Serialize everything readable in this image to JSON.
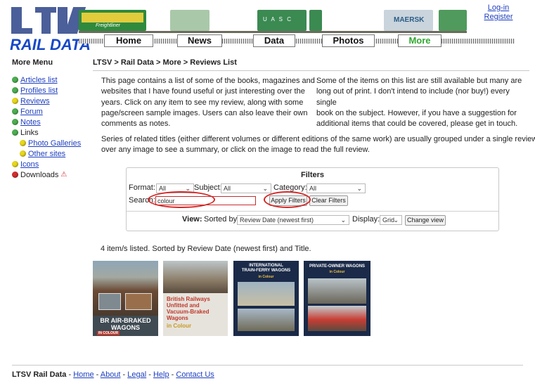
{
  "header": {
    "logo_text": "RAIL DATA",
    "banner": {
      "left_loco_text": "Freightliner",
      "container_text": "U A S C",
      "maersk_text": "MAERSK"
    },
    "login": "Log-in",
    "register": "Register"
  },
  "nav": {
    "tabs": [
      "Home",
      "News",
      "Data",
      "Photos",
      "More"
    ],
    "active": "More"
  },
  "sidebar": {
    "title": "More Menu",
    "items": [
      {
        "label": "Articles list",
        "color": "#4caf50",
        "link": true,
        "indent": false
      },
      {
        "label": "Profiles list",
        "color": "#4caf50",
        "link": true,
        "indent": false
      },
      {
        "label": "Reviews",
        "color": "#e8d81a",
        "link": true,
        "indent": false
      },
      {
        "label": "Forum",
        "color": "#4caf50",
        "link": true,
        "indent": false
      },
      {
        "label": "Notes",
        "color": "#4caf50",
        "link": true,
        "indent": false
      },
      {
        "label": "Links",
        "color": "#4caf50",
        "link": false,
        "indent": false
      },
      {
        "label": "Photo Galleries",
        "color": "#e8d81a",
        "link": true,
        "indent": true
      },
      {
        "label": "Other sites",
        "color": "#e8d81a",
        "link": true,
        "indent": true
      },
      {
        "label": "Icons",
        "color": "#e8d81a",
        "link": true,
        "indent": false
      },
      {
        "label": "Downloads",
        "color": "#d32f2f",
        "link": false,
        "indent": false,
        "warning": "⚠"
      }
    ]
  },
  "main": {
    "breadcrumb": "LTSV > Rail Data > More > Reviews List",
    "intro_left": [
      "This page contains a list of some of the books, magazines and",
      "websites that I have found useful or just interesting over the",
      "years. Click on any item to see my review, along with some",
      "page/screen sample images. Users can also leave their own",
      "comments as notes."
    ],
    "intro_right": [
      "Some of the items on this list are still available but many are",
      "long out of print. I don't intend to include (nor buy!) every single",
      "book on the subject. However, if you have a suggestion for",
      "additional items that could be covered, please get in touch."
    ],
    "series_note": [
      "Series of related titles (either different volumes or different editions of the same work) are usually grouped under a single review. Hover",
      "over any image to see a summary, or click on the image to read the full review."
    ]
  },
  "filters": {
    "title": "Filters",
    "format_label": "Format:",
    "format_value": "All",
    "subject_label": "Subject:",
    "subject_value": "All",
    "category_label": "Category:",
    "category_value": "All",
    "search_label": "Search:",
    "search_value": "colour",
    "apply_label": "Apply Filters",
    "clear_label": "Clear Filters",
    "view_label": "View:",
    "sorted_label": "Sorted by:",
    "sorted_value": "Review Date (newest first)",
    "display_label": "Display:",
    "display_value": "Grid",
    "change_view_label": "Change view",
    "highlight_color": "#d42727"
  },
  "results": {
    "count_text": "4 item/s listed. Sorted by Review Date (newest first) and Title.",
    "covers": [
      {
        "title": "BR AIR-BRAKED\nWAGONS",
        "tag": "IN COLOUR",
        "bg": "#3f4a52",
        "accent": "#c0392b"
      },
      {
        "title": "British Railways\nUnfitted and\nVacuum-Braked Wagons",
        "tag": "in Colour",
        "bg": "#d8dcdc",
        "accent": "#c0392b"
      },
      {
        "title": "INTERNATIONAL\nTRAIN-FERRY WAGONS",
        "tag": "in Colour",
        "bg": "#1a2a48",
        "accent": "#ffffff"
      },
      {
        "title": "PRIVATE-OWNER WAGONS",
        "tag": "in Colour",
        "bg": "#1a2a48",
        "accent": "#ffffff"
      }
    ]
  },
  "footer": {
    "brand": "LTSV Rail Data",
    "links": [
      "Home",
      "About",
      "Legal",
      "Help",
      "Contact Us"
    ]
  }
}
